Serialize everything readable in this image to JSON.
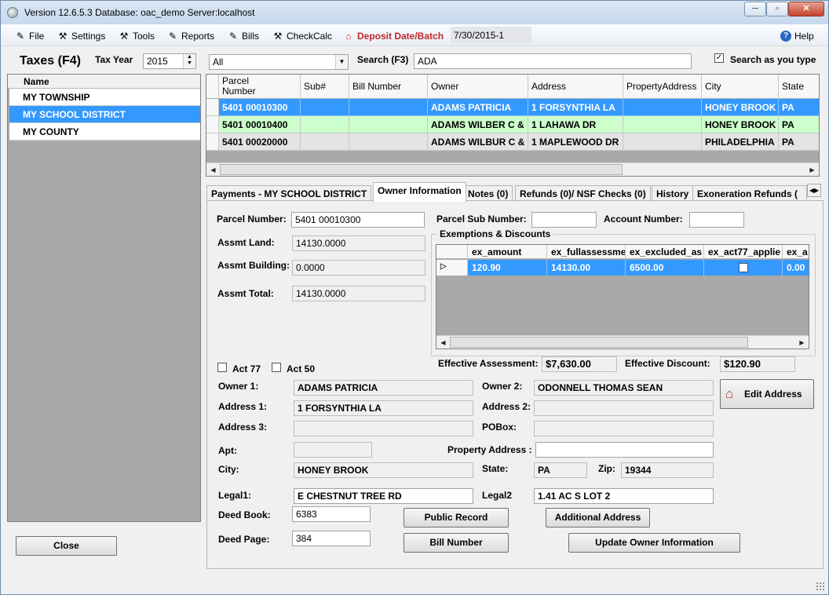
{
  "window": {
    "title": "Version 12.6.5.3 Database: oac_demo Server:localhost",
    "minimize": "─",
    "maximize": "▫",
    "close": "✕"
  },
  "menu": {
    "file": "File",
    "settings": "Settings",
    "tools": "Tools",
    "reports": "Reports",
    "bills": "Bills",
    "checkcalc": "CheckCalc",
    "deposit": "Deposit Date/Batch",
    "deposit_value": "7/30/2015-1",
    "help": "Help"
  },
  "toolbar": {
    "heading": "Taxes (F4)",
    "tax_year_label": "Tax Year",
    "tax_year": "2015",
    "filter": "All",
    "search_label": "Search (F3)",
    "search_value": "ADA",
    "search_as_you_type_label": "Search as you type",
    "search_as_you_type_checked": true
  },
  "left_list": {
    "header": "Name",
    "items": [
      {
        "label": "MY TOWNSHIP",
        "selected": false
      },
      {
        "label": "MY SCHOOL DISTRICT",
        "selected": true
      },
      {
        "label": "MY COUNTY",
        "selected": false
      }
    ],
    "close_button": "Close"
  },
  "parcel_grid": {
    "columns": [
      "Parcel\nNumber",
      "Sub#",
      "Bill Number",
      "Owner",
      "Address",
      "PropertyAddress",
      "City",
      "State"
    ],
    "rows": [
      [
        "5401 00010300",
        "",
        "",
        "ADAMS PATRICIA",
        "1 FORSYNTHIA LA",
        "",
        "HONEY BROOK",
        "PA"
      ],
      [
        "5401 00010400",
        "",
        "",
        "ADAMS WILBER C &",
        "1 LAHAWA DR",
        "",
        "HONEY BROOK",
        "PA"
      ],
      [
        "5401 00020000",
        "",
        "",
        "ADAMS WILBUR C &",
        "1 MAPLEWOOD DR",
        "",
        "PHILADELPHIA",
        "PA"
      ]
    ],
    "row_colors": [
      "#3399ff",
      "#ccffcc",
      "#e4e4e4"
    ]
  },
  "tabs": {
    "items": [
      "Payments - MY SCHOOL DISTRICT",
      "Owner Information",
      "Notes (0)",
      "Refunds (0)/ NSF Checks (0)",
      "History",
      "Exoneration Refunds ("
    ],
    "active_index": 1
  },
  "owner_info": {
    "parcel_number_label": "Parcel Number:",
    "parcel_number": "5401 00010300",
    "parcel_sub_number_label": "Parcel Sub Number:",
    "parcel_sub_number": "",
    "account_number_label": "Account Number:",
    "account_number": "",
    "assmt_land_label": "Assmt Land:",
    "assmt_land": "14130.0000",
    "assmt_building_label": "Assmt Building:",
    "assmt_building": "0.0000",
    "assmt_total_label": "Assmt Total:",
    "assmt_total": "14130.0000",
    "act77_label": "Act 77",
    "act50_label": "Act 50",
    "owner1_label": "Owner 1:",
    "owner1": "ADAMS PATRICIA",
    "owner2_label": "Owner 2:",
    "owner2": "ODONNELL THOMAS SEAN",
    "address1_label": "Address 1:",
    "address1": "1 FORSYNTHIA LA",
    "address2_label": "Address 2:",
    "address2": "",
    "address3_label": "Address 3:",
    "address3": "",
    "pobox_label": "POBox:",
    "pobox": "",
    "apt_label": "Apt:",
    "apt": "",
    "property_address_label": "Property Address :",
    "property_address": "",
    "city_label": "City:",
    "city": "HONEY BROOK",
    "state_label": "State:",
    "state": "PA",
    "zip_label": "Zip:",
    "zip": "19344",
    "legal1_label": "Legal1:",
    "legal1": "E CHESTNUT TREE RD",
    "legal2_label": "Legal2",
    "legal2": "1.41 AC S LOT 2",
    "deed_book_label": "Deed Book:",
    "deed_book": "6383",
    "deed_page_label": "Deed Page:",
    "deed_page": "384",
    "edit_address_button": "Edit Address",
    "public_record_button": "Public Record",
    "additional_address_button": "Additional Address",
    "bill_number_button": "Bill Number",
    "update_owner_button": "Update Owner Information"
  },
  "exemptions": {
    "group_label": "Exemptions & Discounts",
    "columns": [
      "ex_amount",
      "ex_fullassessme",
      "ex_excluded_as",
      "ex_act77_applie",
      "ex_a"
    ],
    "row": {
      "ex_amount": "120.90",
      "ex_fullassessment": "14130.00",
      "ex_excluded": "6500.00",
      "ex_act77_checked": false,
      "ex_a": "0.00"
    },
    "effective_assessment_label": "Effective Assessment:",
    "effective_assessment": "$7,630.00",
    "effective_discount_label": "Effective Discount:",
    "effective_discount": "$120.90"
  },
  "colors": {
    "selection": "#3399ff",
    "green_row": "#ccffcc",
    "deposit_red": "#c0282e",
    "grid_bg": "#a9a9a9"
  }
}
